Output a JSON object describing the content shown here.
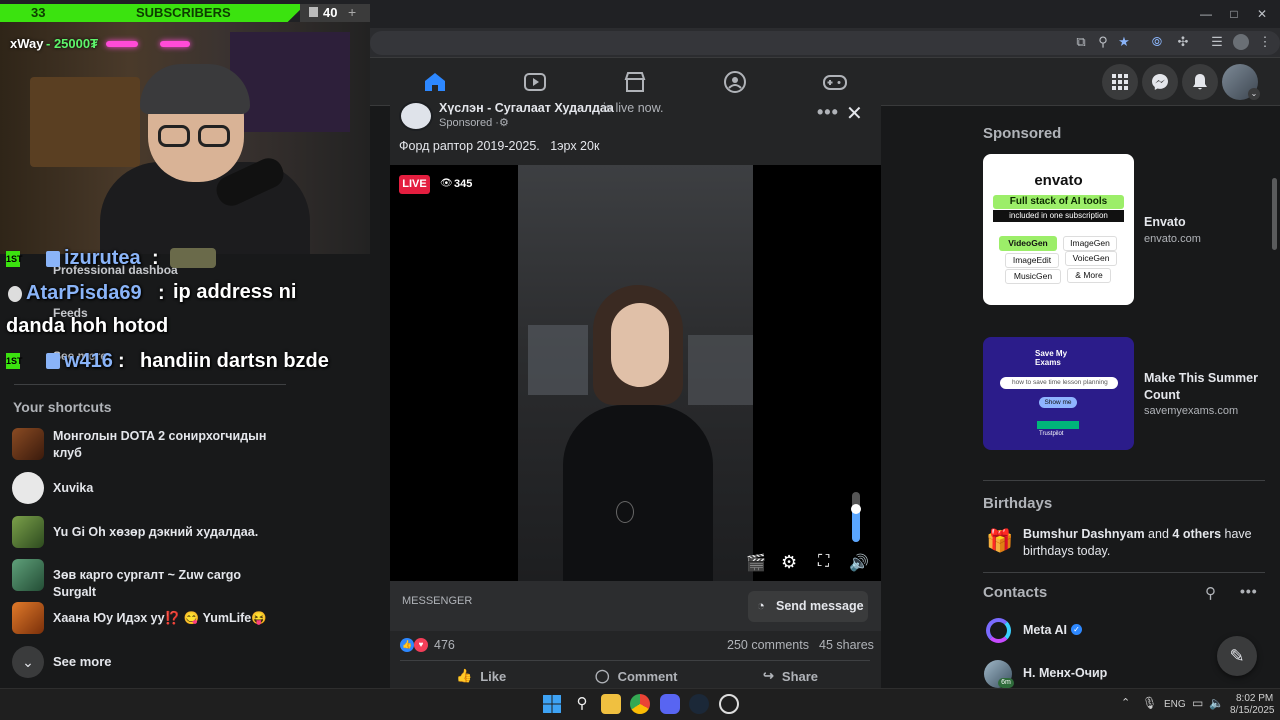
{
  "browser": {
    "window_controls": [
      "—",
      "□",
      "✕"
    ]
  },
  "stream_overlay": {
    "sub_count": "33",
    "sub_label": "SUBSCRIBERS",
    "sub_goal": "40",
    "donation_name": "xWay",
    "donation_amount": "- 25000₮",
    "chat": [
      {
        "user": "izurutea",
        "message": ""
      },
      {
        "user": "AtarPisda69",
        "message": "ip address ni danda hoh hotod"
      },
      {
        "user": "w416",
        "message": "handiin dartsn bzde"
      }
    ],
    "ghost_texts": [
      "Professional dashboa",
      "Feeds",
      "See more"
    ]
  },
  "left_sidebar": {
    "shortcuts_title": "Your shortcuts",
    "shortcuts": [
      {
        "label": "Монголын DOTA 2 сонирхогчидын клуб",
        "color": "#6b3a1f"
      },
      {
        "label": "Xuvika",
        "color": "#d9d9d9"
      },
      {
        "label": "Yu Gi Oh хөзөр дэкний худалдаа.",
        "color": "#5a7a3a"
      },
      {
        "label": "Зөв карго сургалт ~ Zuw cargo Surgalt",
        "color": "#3f6f52"
      },
      {
        "label": "Хаана Юу Идэх уу⁉️ 😋 YumLife😝",
        "color": "#b05a1a"
      }
    ],
    "see_more": "See more"
  },
  "post": {
    "author": "Хүслэн - Сугалаат Худалдаа",
    "status": "is live now.",
    "sponsored": "Sponsored ·",
    "caption": "Форд раптор 2019-2025.   1эрх 20к",
    "live_label": "LIVE",
    "viewers": "345",
    "messenger_label": "MESSENGER",
    "send_message": "Send message",
    "reactions_count": "476",
    "comments": "250 comments",
    "shares": "45 shares",
    "like": "Like",
    "comment": "Comment",
    "share": "Share"
  },
  "right_column": {
    "sponsored_title": "Sponsored",
    "ads": [
      {
        "name": "Envato",
        "domain": "envato.com",
        "brand": "envato",
        "headline": "Full stack of AI tools",
        "sub": "included in one subscription",
        "tags": [
          "VideoGen",
          "ImageGen",
          "ImageEdit",
          "VoiceGen",
          "MusicGen",
          "& More"
        ]
      },
      {
        "name": "Make This Summer Count",
        "domain": "savemyexams.com",
        "brand": "Save My Exams",
        "search_text": "how to save time lesson planning",
        "button": "Show me",
        "rating": "Trustpilot"
      }
    ],
    "birthdays_title": "Birthdays",
    "birthday_name": "Bumshur Dashnyam",
    "birthday_and": "and",
    "birthday_others": "4 others",
    "birthday_rest": "have birthdays today.",
    "contacts_title": "Contacts",
    "contacts": [
      {
        "name": "Meta AI",
        "verified": true
      },
      {
        "name": "Н. Менх-Очир",
        "badge": "6m"
      }
    ]
  },
  "taskbar": {
    "lang": "ENG",
    "time": "8:02 PM",
    "date": "8/15/2025"
  },
  "colors": {
    "accent": "#2d88ff",
    "live": "#e41e3f",
    "sub_bar": "#3be30f",
    "envato_green": "#9cee69"
  }
}
